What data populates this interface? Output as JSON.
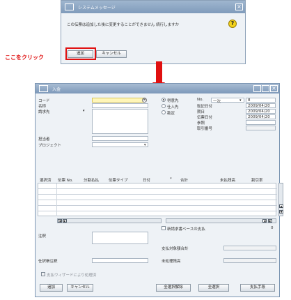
{
  "dialog": {
    "title": "システムメッセージ",
    "message": "この伝票は追加した後に変更することができません 続行しますか",
    "ok_label": "追加",
    "cancel_label": "キャンセル",
    "icon": "question-icon"
  },
  "annotation": {
    "click_here": "ここをクリック",
    "arrow": "down-arrow"
  },
  "window": {
    "title": "入金",
    "left_labels": {
      "code": "コード",
      "name": "名称",
      "payer": "請求先",
      "person": "担当者",
      "project": "プロジェクト"
    },
    "radios": [
      {
        "label": "得意先",
        "selected": true
      },
      {
        "label": "仕入先",
        "selected": false
      },
      {
        "label": "勘定",
        "selected": false
      }
    ],
    "right": {
      "no_label": "No.",
      "series_value": "一次",
      "number_value": "8",
      "posting_date_label": "転記日付",
      "posting_date": "2009/04/20",
      "due_date_label": "期日",
      "due_date": "2009/04/20",
      "doc_date_label": "伝票日付",
      "doc_date": "2009/04/20",
      "reference_label": "参照",
      "transaction_no_label": "取引番号"
    },
    "table": {
      "columns": [
        "選択済",
        "伝票 No.",
        "分割払払",
        "伝票タイプ",
        "日付",
        "*",
        "合計",
        "未払残高",
        "割引率"
      ]
    },
    "partial_payment_label": "新請求書ベースの支払",
    "partial_payment_value": "0",
    "remarks_label": "注釈",
    "journal_remarks_label": "仕訳帳注釈",
    "payment_total_label": "支払対象額合計",
    "open_balance_label": "未処理残高",
    "wizard_label": "支払ウィザードにより処理済",
    "buttons": {
      "add": "追加",
      "cancel": "キャンセル",
      "deselect_all": "全選択解除",
      "select_all": "全選択",
      "payment_means": "支払手段"
    }
  },
  "colors": {
    "titlebar": "#7f9bbb",
    "accent_red": "#e01010",
    "required_field": "#fff6b8"
  }
}
